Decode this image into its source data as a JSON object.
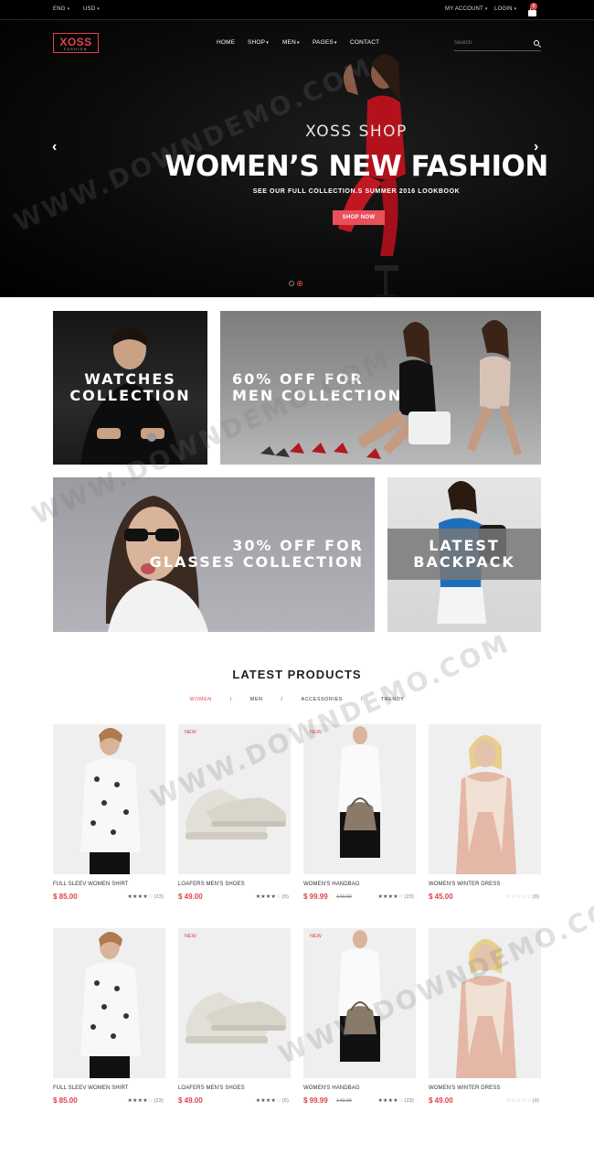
{
  "topbar": {
    "language": "ENG",
    "currency": "USD",
    "account": "MY ACCOUNT",
    "login": "LOGIN",
    "cart_count": "0"
  },
  "header": {
    "logo_main": "XOSS",
    "logo_sub": "FASHION",
    "nav": [
      "HOME",
      "SHOP",
      "MEN",
      "PAGES",
      "CONTACT"
    ],
    "search_placeholder": "Search"
  },
  "hero": {
    "subtitle": "XOSS SHOP",
    "title": "WOMEN’S NEW FASHION",
    "description": "SEE OUR FULL COLLECTION.S SUMMER 2016 LOOKBOOK",
    "button": "SHOP NOW",
    "slides": 2,
    "active_slide": 2
  },
  "banners": [
    {
      "line1": "WATCHES",
      "line2": "COLLECTION"
    },
    {
      "line1": "60% OFF FOR",
      "line2": "MEN COLLECTION"
    },
    {
      "line1": "30% OFF FOR",
      "line2": "GLASSES COLLECTION"
    },
    {
      "line1": "LATEST",
      "line2": "BACKPACK"
    }
  ],
  "products_section": {
    "title": "LATEST PRODUCTS",
    "filters": [
      "WOMEN",
      "MEN",
      "ACCESSORIES",
      "TRENDY"
    ],
    "active_filter": "WOMEN"
  },
  "products": [
    {
      "name": "FULL SLEEV WOMEN SHIRT",
      "price": "$ 85.00",
      "old_price": "",
      "badge": "",
      "rating": 4,
      "reviews": "(23)"
    },
    {
      "name": "LOAFERS MEN'S SHOES",
      "price": "$ 49.00",
      "old_price": "",
      "badge": "NEW",
      "rating": 4,
      "reviews": "(5)"
    },
    {
      "name": "WOMEN'S HANDBAG",
      "price": "$ 99.99",
      "old_price": "149.00",
      "badge": "NEW",
      "rating": 4,
      "reviews": "(23)"
    },
    {
      "name": "WOMEN'S WINTER DRESS",
      "price": "$ 45.00",
      "old_price": "",
      "badge": "",
      "rating": 0,
      "reviews": "(0)"
    },
    {
      "name": "FULL SLEEV WOMEN SHIRT",
      "price": "$ 85.00",
      "old_price": "",
      "badge": "",
      "rating": 4,
      "reviews": "(23)"
    },
    {
      "name": "LOAFERS MEN'S SHOES",
      "price": "$ 49.00",
      "old_price": "",
      "badge": "NEW",
      "rating": 4,
      "reviews": "(5)"
    },
    {
      "name": "WOMEN'S HANDBAG",
      "price": "$ 99.99",
      "old_price": "149.00",
      "badge": "NEW",
      "rating": 4,
      "reviews": "(23)"
    },
    {
      "name": "WOMEN'S WINTER DRESS",
      "price": "$ 49.00",
      "old_price": "",
      "badge": "",
      "rating": 0,
      "reviews": "(0)"
    }
  ],
  "watermark": "WWW.DOWNDEMO.COM",
  "colors": {
    "accent": "#e0434a",
    "hero_bg": "#000000",
    "text": "#222222"
  }
}
